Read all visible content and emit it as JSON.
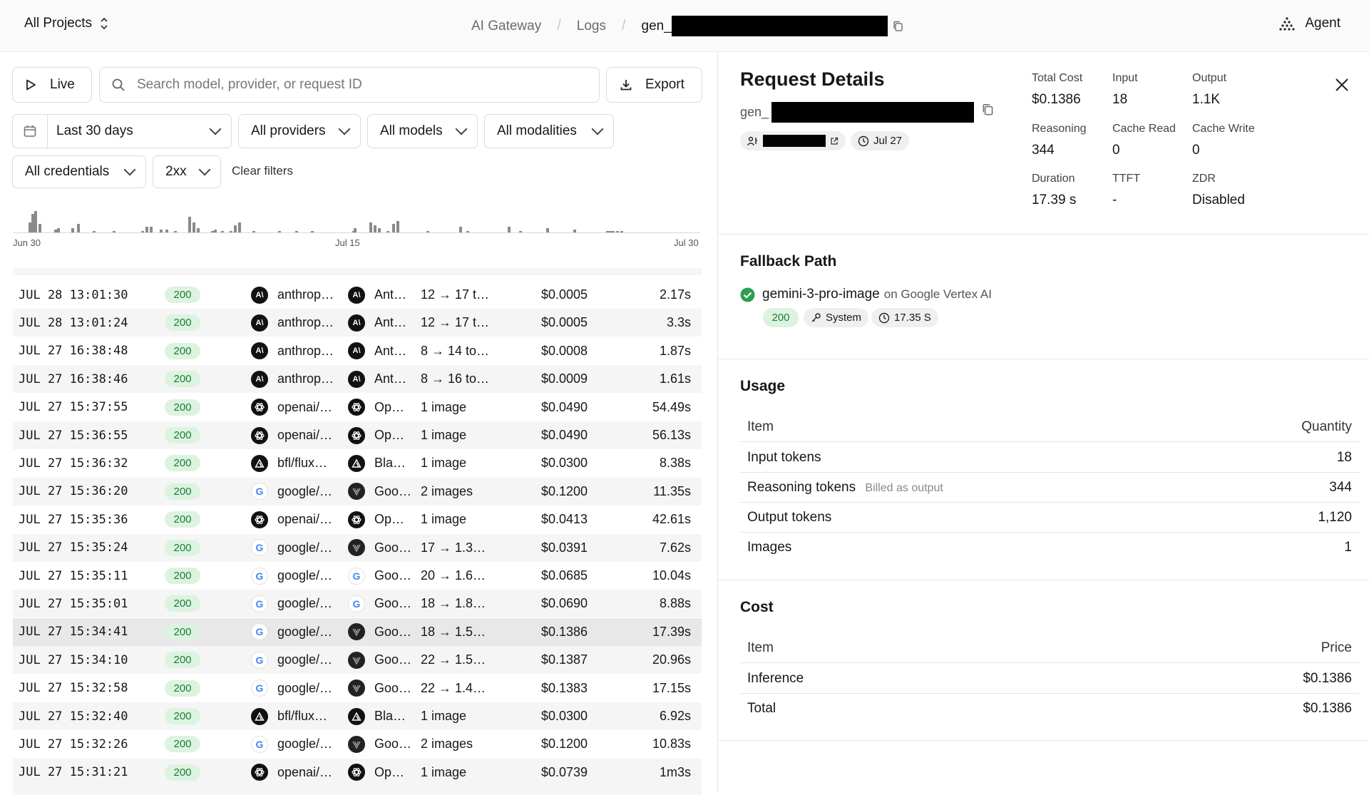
{
  "topbar": {
    "project": "All Projects",
    "breadcrumbs": [
      "AI Gateway",
      "Logs"
    ],
    "current_prefix": "gen_",
    "agent_label": "Agent"
  },
  "toolbar": {
    "live_label": "Live",
    "search_placeholder": "Search model, provider, or request ID",
    "export_label": "Export"
  },
  "filters": {
    "date_range": "Last 30 days",
    "providers": "All providers",
    "models": "All models",
    "modalities": "All modalities",
    "credentials": "All credentials",
    "status": "2xx",
    "clear_label": "Clear filters"
  },
  "histogram": {
    "axis_labels": [
      "Jun 30",
      "Jul 15",
      "Jul 30"
    ]
  },
  "logs": [
    {
      "time": "JUL 28 13:01:30",
      "status": "200",
      "provider": "anthrop…",
      "provider_icon": "anthropic-icon",
      "model": "Ant…",
      "model_icon": "anthropic-icon",
      "summary": "12 → 17 t…",
      "cost": "$0.0005",
      "duration": "2.17s"
    },
    {
      "time": "JUL 28 13:01:24",
      "status": "200",
      "provider": "anthrop…",
      "provider_icon": "anthropic-icon",
      "model": "Ant…",
      "model_icon": "anthropic-icon",
      "summary": "12 → 17 t…",
      "cost": "$0.0005",
      "duration": "3.3s"
    },
    {
      "time": "JUL 27 16:38:48",
      "status": "200",
      "provider": "anthrop…",
      "provider_icon": "anthropic-icon",
      "model": "Ant…",
      "model_icon": "anthropic-icon",
      "summary": "8 → 14 to…",
      "cost": "$0.0008",
      "duration": "1.87s"
    },
    {
      "time": "JUL 27 16:38:46",
      "status": "200",
      "provider": "anthrop…",
      "provider_icon": "anthropic-icon",
      "model": "Ant…",
      "model_icon": "anthropic-icon",
      "summary": "8 → 16 to…",
      "cost": "$0.0009",
      "duration": "1.61s"
    },
    {
      "time": "JUL 27 15:37:55",
      "status": "200",
      "provider": "openai/…",
      "provider_icon": "openai-icon",
      "model": "Op…",
      "model_icon": "openai-icon",
      "summary": "1 image",
      "cost": "$0.0490",
      "duration": "54.49s"
    },
    {
      "time": "JUL 27 15:36:55",
      "status": "200",
      "provider": "openai/…",
      "provider_icon": "openai-icon",
      "model": "Op…",
      "model_icon": "openai-icon",
      "summary": "1 image",
      "cost": "$0.0490",
      "duration": "56.13s"
    },
    {
      "time": "JUL 27 15:36:32",
      "status": "200",
      "provider": "bfl/flux…",
      "provider_icon": "bfl-icon",
      "model": "Bla…",
      "model_icon": "bfl-icon",
      "summary": "1 image",
      "cost": "$0.0300",
      "duration": "8.38s"
    },
    {
      "time": "JUL 27 15:36:20",
      "status": "200",
      "provider": "google/…",
      "provider_icon": "google-icon",
      "model": "Goo…",
      "model_icon": "vertex-icon",
      "summary": "2 images",
      "cost": "$0.1200",
      "duration": "11.35s"
    },
    {
      "time": "JUL 27 15:35:36",
      "status": "200",
      "provider": "openai/…",
      "provider_icon": "openai-icon",
      "model": "Op…",
      "model_icon": "openai-icon",
      "summary": "1 image",
      "cost": "$0.0413",
      "duration": "42.61s"
    },
    {
      "time": "JUL 27 15:35:24",
      "status": "200",
      "provider": "google/…",
      "provider_icon": "google-icon",
      "model": "Goo…",
      "model_icon": "vertex-icon",
      "summary": "17 → 1.3…",
      "cost": "$0.0391",
      "duration": "7.62s"
    },
    {
      "time": "JUL 27 15:35:11",
      "status": "200",
      "provider": "google/…",
      "provider_icon": "google-icon",
      "model": "Goo…",
      "model_icon": "google-icon",
      "summary": "20 → 1.6…",
      "cost": "$0.0685",
      "duration": "10.04s"
    },
    {
      "time": "JUL 27 15:35:01",
      "status": "200",
      "provider": "google/…",
      "provider_icon": "google-icon",
      "model": "Goo…",
      "model_icon": "google-icon",
      "summary": "18 → 1.8…",
      "cost": "$0.0690",
      "duration": "8.88s"
    },
    {
      "time": "JUL 27 15:34:41",
      "status": "200",
      "provider": "google/…",
      "provider_icon": "google-icon",
      "model": "Goo…",
      "model_icon": "vertex-icon",
      "summary": "18 → 1.5…",
      "cost": "$0.1386",
      "duration": "17.39s",
      "selected": true
    },
    {
      "time": "JUL 27 15:34:10",
      "status": "200",
      "provider": "google/…",
      "provider_icon": "google-icon",
      "model": "Goo…",
      "model_icon": "vertex-icon",
      "summary": "22 → 1.5…",
      "cost": "$0.1387",
      "duration": "20.96s"
    },
    {
      "time": "JUL 27 15:32:58",
      "status": "200",
      "provider": "google/…",
      "provider_icon": "google-icon",
      "model": "Goo…",
      "model_icon": "vertex-icon",
      "summary": "22 → 1.4…",
      "cost": "$0.1383",
      "duration": "17.15s"
    },
    {
      "time": "JUL 27 15:32:40",
      "status": "200",
      "provider": "bfl/flux…",
      "provider_icon": "bfl-icon",
      "model": "Bla…",
      "model_icon": "bfl-icon",
      "summary": "1 image",
      "cost": "$0.0300",
      "duration": "6.92s"
    },
    {
      "time": "JUL 27 15:32:26",
      "status": "200",
      "provider": "google/…",
      "provider_icon": "google-icon",
      "model": "Goo…",
      "model_icon": "vertex-icon",
      "summary": "2 images",
      "cost": "$0.1200",
      "duration": "10.83s"
    },
    {
      "time": "JUL 27 15:31:21",
      "status": "200",
      "provider": "openai/…",
      "provider_icon": "openai-icon",
      "model": "Op…",
      "model_icon": "openai-icon",
      "summary": "1 image",
      "cost": "$0.0739",
      "duration": "1m3s"
    }
  ],
  "details": {
    "title": "Request Details",
    "id_prefix": "gen_",
    "date_pill": "Jul 27",
    "stats": [
      {
        "label": "Total Cost",
        "value": "$0.1386"
      },
      {
        "label": "Input",
        "value": "18"
      },
      {
        "label": "Output",
        "value": "1.1K"
      },
      {
        "label": "Reasoning",
        "value": "344"
      },
      {
        "label": "Cache Read",
        "value": "0"
      },
      {
        "label": "Cache Write",
        "value": "0"
      },
      {
        "label": "Duration",
        "value": "17.39 s"
      },
      {
        "label": "TTFT",
        "value": "-"
      },
      {
        "label": "ZDR",
        "value": "Disabled"
      }
    ],
    "fallback": {
      "title": "Fallback Path",
      "model": "gemini-3-pro-image",
      "on_text": "on Google Vertex AI",
      "status": "200",
      "auth": "System",
      "time": "17.35 S"
    },
    "usage": {
      "title": "Usage",
      "col_item": "Item",
      "col_qty": "Quantity",
      "rows": [
        {
          "item": "Input tokens",
          "note": "",
          "value": "18"
        },
        {
          "item": "Reasoning tokens",
          "note": "Billed as output",
          "value": "344"
        },
        {
          "item": "Output tokens",
          "note": "",
          "value": "1,120"
        },
        {
          "item": "Images",
          "note": "",
          "value": "1"
        }
      ]
    },
    "cost": {
      "title": "Cost",
      "col_item": "Item",
      "col_price": "Price",
      "rows": [
        {
          "item": "Inference",
          "value": "$0.1386"
        },
        {
          "item": "Total",
          "value": "$0.1386"
        }
      ]
    }
  },
  "colors": {
    "success_bg": "#dcf3df",
    "success_fg": "#1f7a3a",
    "check_green": "#2e9e4f"
  }
}
